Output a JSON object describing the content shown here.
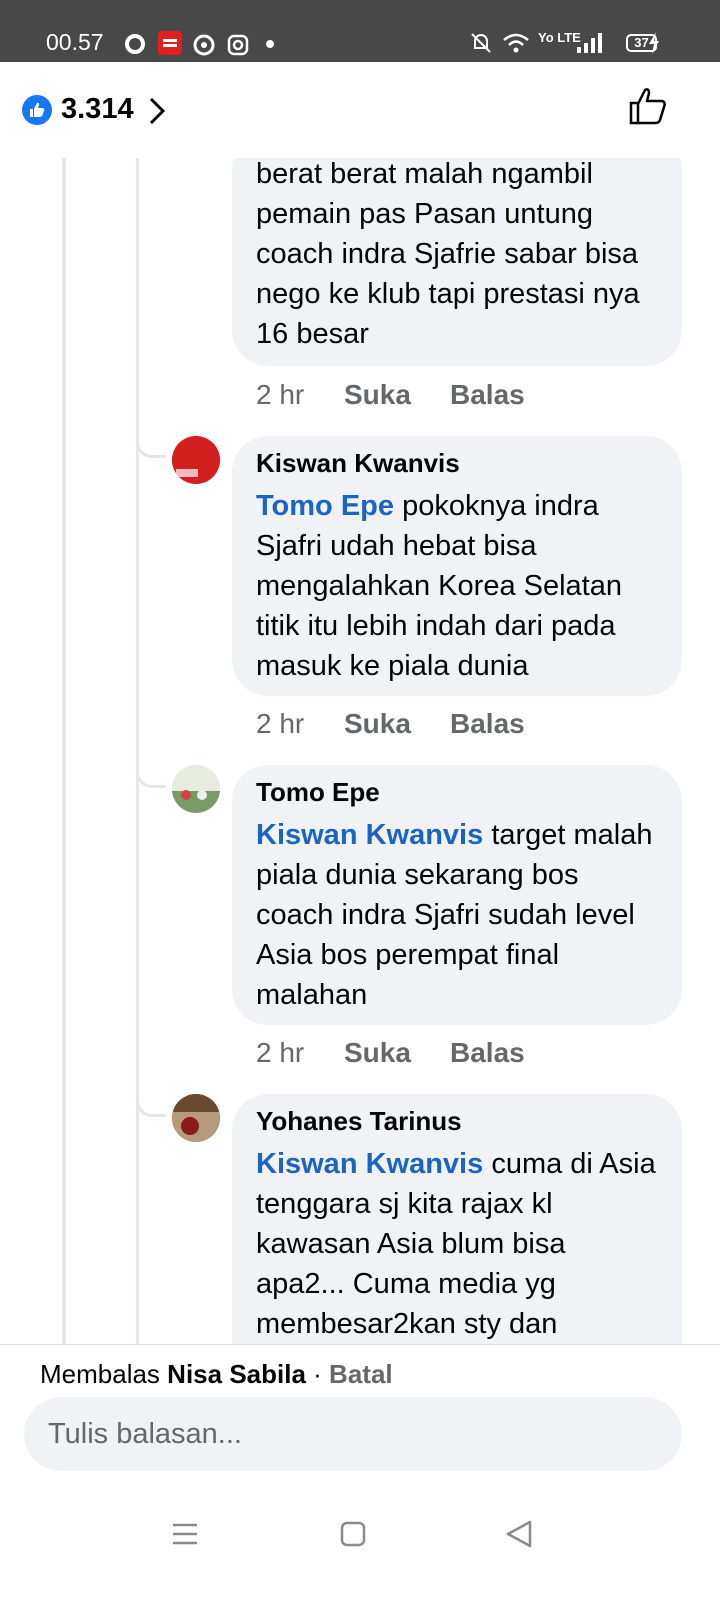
{
  "status_bar": {
    "time": "00.57",
    "network_label": "Yo LTE",
    "battery": "37"
  },
  "header": {
    "like_count": "3.314",
    "icons": [
      "like-badge-icon",
      "chevron-right-icon",
      "thumbs-up-icon"
    ]
  },
  "comments": [
    {
      "author": "",
      "mention": "",
      "text": "berat berat malah ngambil pemain pas Pasan  untung coach indra Sjafrie sabar bisa nego ke klub tapi prestasi nya 16 besar",
      "time": "2 hr",
      "like_label": "Suka",
      "reply_label": "Balas"
    },
    {
      "author": "Kiswan Kwanvis",
      "mention": "Tomo Epe",
      "text": "pokoknya indra Sjafri udah hebat bisa mengalahkan Korea Selatan titik itu lebih indah dari pada masuk ke piala dunia",
      "time": "2 hr",
      "like_label": "Suka",
      "reply_label": "Balas"
    },
    {
      "author": "Tomo Epe",
      "mention": "Kiswan Kwanvis",
      "text": "target malah piala dunia sekarang bos coach indra Sjafri sudah level Asia bos perempat final malahan",
      "time": "2 hr",
      "like_label": "Suka",
      "reply_label": "Balas"
    },
    {
      "author": "Yohanes Tarinus",
      "mention": "Kiswan Kwanvis",
      "text": "cuma di Asia tenggara sj kita rajax kl kawasan Asia blum bisa apa2... Cuma media yg membesar2kan sty dan"
    }
  ],
  "reply_bar": {
    "replying_label": "Membalas",
    "replying_to": "Nisa Sabila",
    "separator": "·",
    "cancel_label": "Batal",
    "placeholder": "Tulis balasan..."
  },
  "colors": {
    "status_bar_bg": "#484848",
    "bubble_bg": "#f0f2f5",
    "mention": "#1b64c4",
    "meta_text": "#65676b",
    "like_blue": "#1877f2"
  }
}
